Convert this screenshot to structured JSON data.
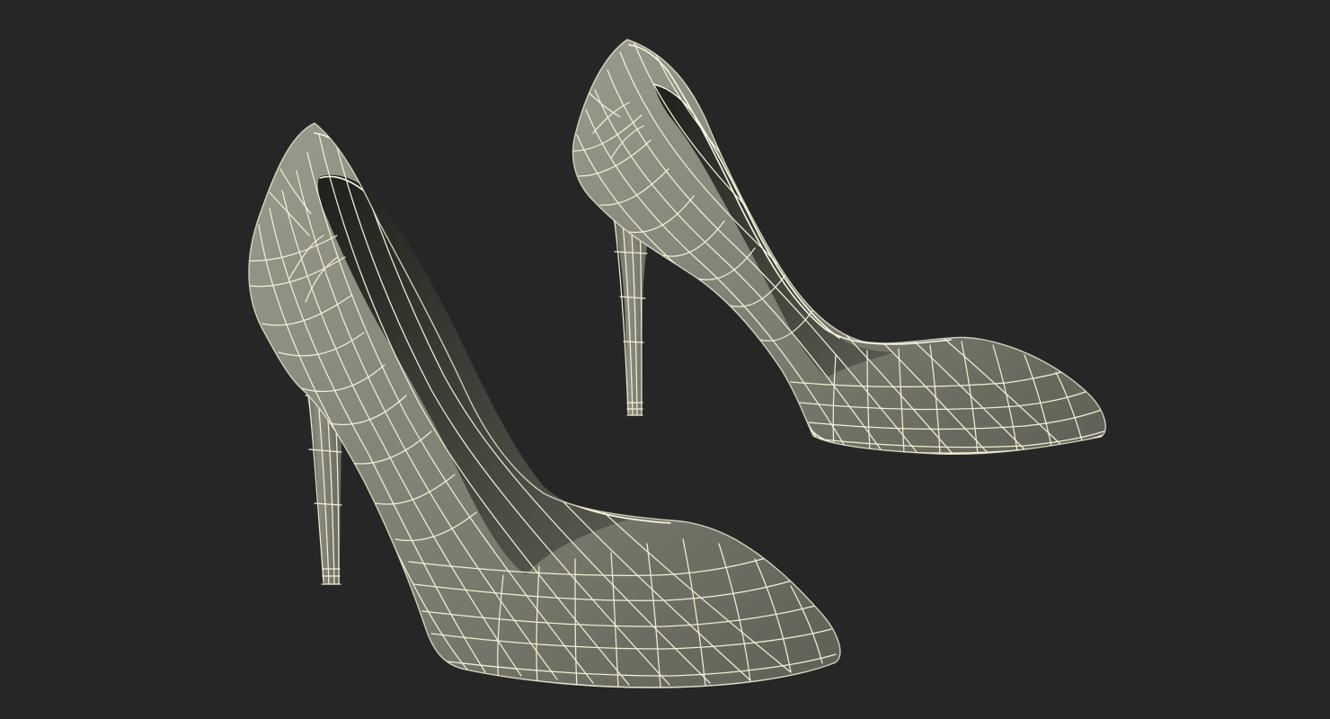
{
  "scene": {
    "background_color": "#262626",
    "render_style": "wireframe over shaded model",
    "model_surface_color": "#7e7e72",
    "model_shadow_color": "#4b4b43",
    "interior_color": "#2f302b",
    "wire_color": "#f2efd6",
    "objects": [
      {
        "name": "left-shoe",
        "type": "pointed-toe stiletto pump"
      },
      {
        "name": "right-shoe",
        "type": "pointed-toe stiletto pump"
      }
    ]
  }
}
